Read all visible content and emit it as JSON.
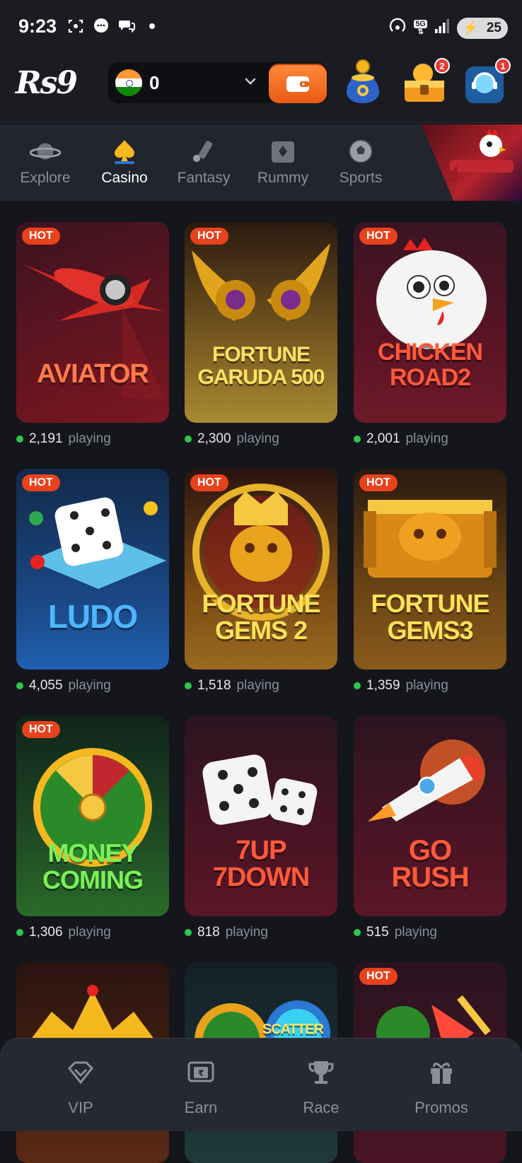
{
  "status_bar": {
    "time": "9:23",
    "battery": "25",
    "network": "5G"
  },
  "header": {
    "logo": "Rs9",
    "balance": "0",
    "badges": {
      "chest": "2",
      "support": "1"
    }
  },
  "nav": {
    "items": [
      {
        "label": "Explore",
        "icon": "planet-icon"
      },
      {
        "label": "Casino",
        "icon": "spade-icon"
      },
      {
        "label": "Fantasy",
        "icon": "cricket-bat-icon"
      },
      {
        "label": "Rummy",
        "icon": "cards-icon"
      },
      {
        "label": "Sports",
        "icon": "soccer-ball-icon"
      }
    ],
    "active": "Casino"
  },
  "games": [
    {
      "title": "AVIATOR",
      "hot": "HOT",
      "players": "2,191",
      "playing_label": "playing"
    },
    {
      "title": "FORTUNE GARUDA 500",
      "hot": "HOT",
      "players": "2,300",
      "playing_label": "playing"
    },
    {
      "title": "CHICKEN ROAD2",
      "hot": "HOT",
      "players": "2,001",
      "playing_label": "playing"
    },
    {
      "title": "LUDO",
      "hot": "HOT",
      "players": "4,055",
      "playing_label": "playing"
    },
    {
      "title": "FORTUNE GEMS 2",
      "hot": "HOT",
      "players": "1,518",
      "playing_label": "playing"
    },
    {
      "title": "FORTUNE GEMS3",
      "hot": "HOT",
      "players": "1,359",
      "playing_label": "playing"
    },
    {
      "title": "MONEY COMING",
      "hot": "HOT",
      "players": "1,306",
      "playing_label": "playing"
    },
    {
      "title": "7UP 7DOWN",
      "hot": "",
      "players": "818",
      "playing_label": "playing"
    },
    {
      "title": "GO RUSH",
      "hot": "",
      "players": "515",
      "playing_label": "playing"
    }
  ],
  "partial_row": [
    {
      "hot": ""
    },
    {
      "hot": "",
      "title": "SCATTER"
    },
    {
      "hot": "HOT"
    }
  ],
  "bottom_nav": [
    {
      "label": "VIP",
      "icon": "vip-diamond-icon"
    },
    {
      "label": "Earn",
      "icon": "earn-card-icon"
    },
    {
      "label": "Race",
      "icon": "trophy-icon"
    },
    {
      "label": "Promos",
      "icon": "gift-icon"
    }
  ],
  "colors": {
    "accent": "#ea5a14",
    "hot_badge": "#e8421d",
    "online_dot": "#2ec74f",
    "background": "#14161c"
  }
}
